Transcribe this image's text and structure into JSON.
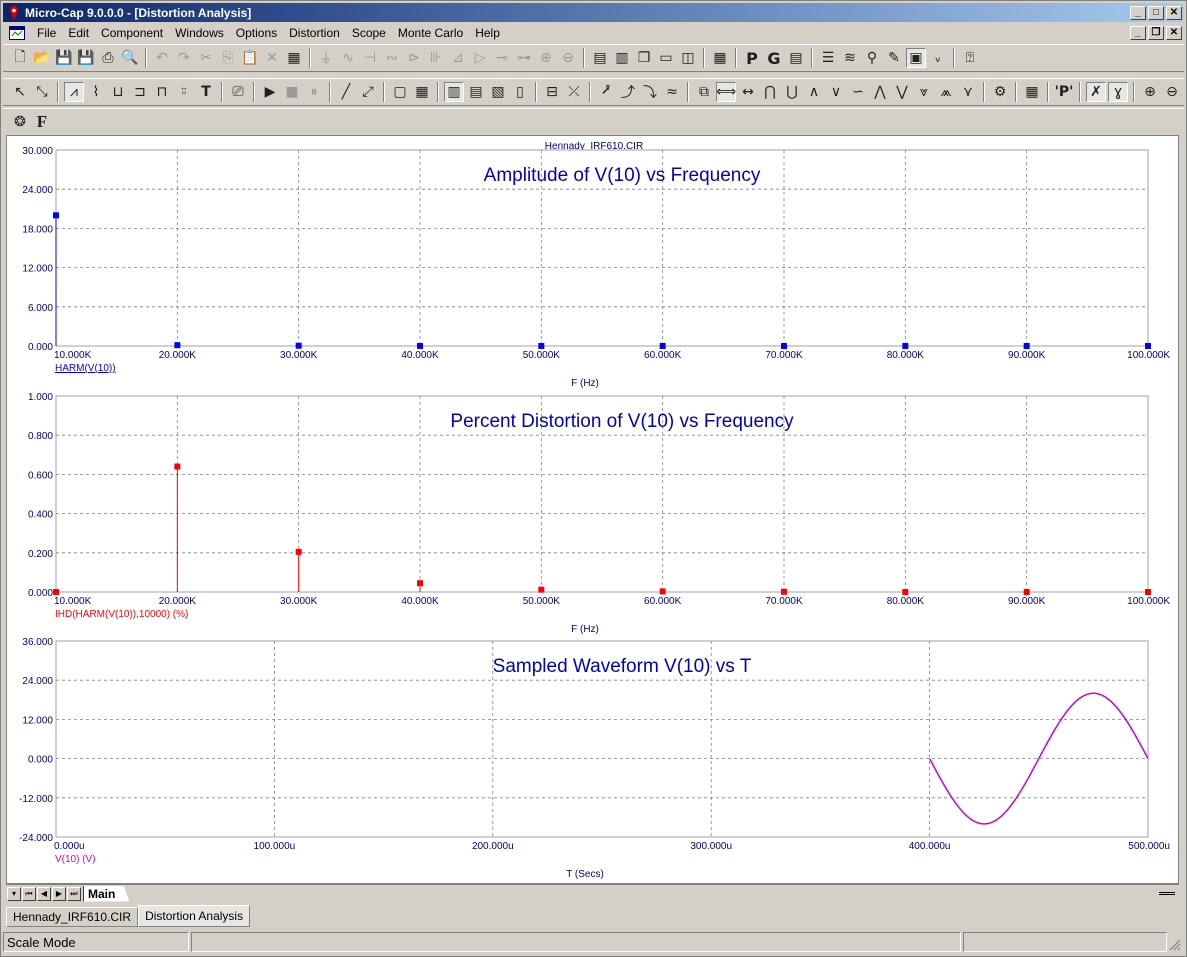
{
  "window": {
    "title": "Micro-Cap 9.0.0.0 - [Distortion Analysis]",
    "min": "_",
    "max": "□",
    "close": "✕",
    "mdi_min": "_",
    "mdi_restore": "❐",
    "mdi_close": "✕"
  },
  "menu": [
    "File",
    "Edit",
    "Component",
    "Windows",
    "Options",
    "Distortion",
    "Scope",
    "Monte Carlo",
    "Help"
  ],
  "toolbar_extra": {
    "f_label": "F"
  },
  "plot": {
    "filename": "Hennady_IRF610.CIR",
    "colors": {
      "axis_text": "#000080",
      "grid": "#808080",
      "amplitude": "#0000ff",
      "distortion": "#ff0000",
      "waveform": "#cc00cc"
    }
  },
  "sheet_tabs": {
    "nav": [
      "▾",
      "⏮",
      "◀",
      "▶",
      "⏭"
    ],
    "active": "Main"
  },
  "doc_tabs": [
    "Hennady_IRF610.CIR",
    "Distortion Analysis"
  ],
  "status": {
    "mode": "Scale Mode"
  },
  "chart_data": [
    {
      "type": "bar",
      "title": "Amplitude of V(10) vs Frequency",
      "xlabel": "F (Hz)",
      "ylabel": "",
      "trace_label": "HARM(V(10))",
      "xlim": [
        10000,
        100000
      ],
      "ylim": [
        0,
        30
      ],
      "xticks": [
        "10.000K",
        "20.000K",
        "30.000K",
        "40.000K",
        "50.000K",
        "60.000K",
        "70.000K",
        "80.000K",
        "90.000K",
        "100.000K"
      ],
      "yticks": [
        "0.000",
        "6.000",
        "12.000",
        "18.000",
        "24.000",
        "30.000"
      ],
      "x": [
        10000,
        20000,
        30000,
        40000,
        50000,
        60000,
        70000,
        80000,
        90000,
        100000
      ],
      "values": [
        20.0,
        0.13,
        0.04,
        0.01,
        0.003,
        0.001,
        0.0,
        0.0,
        0.0,
        0.0
      ],
      "grid": true
    },
    {
      "type": "bar",
      "title": "Percent Distortion of V(10) vs Frequency",
      "xlabel": "F (Hz)",
      "ylabel": "",
      "trace_label": "IHD(HARM(V(10)),10000) (%)",
      "xlim": [
        10000,
        100000
      ],
      "ylim": [
        0,
        1
      ],
      "xticks": [
        "10.000K",
        "20.000K",
        "30.000K",
        "40.000K",
        "50.000K",
        "60.000K",
        "70.000K",
        "80.000K",
        "90.000K",
        "100.000K"
      ],
      "yticks": [
        "0.000",
        "0.200",
        "0.400",
        "0.600",
        "0.800",
        "1.000"
      ],
      "x": [
        10000,
        20000,
        30000,
        40000,
        50000,
        60000,
        70000,
        80000,
        90000,
        100000
      ],
      "values": [
        0.0,
        0.64,
        0.205,
        0.045,
        0.012,
        0.003,
        0.001,
        0.0,
        0.0,
        0.0
      ],
      "grid": true
    },
    {
      "type": "line",
      "title": "Sampled Waveform  V(10) vs T",
      "xlabel": "T (Secs)",
      "ylabel": "",
      "trace_label": "V(10) (V)",
      "xlim": [
        0,
        500
      ],
      "ylim": [
        -24,
        36
      ],
      "xticks": [
        "0.000u",
        "100.000u",
        "200.000u",
        "300.000u",
        "400.000u",
        "500.000u"
      ],
      "yticks": [
        "-24.000",
        "-12.000",
        "0.000",
        "12.000",
        "24.000",
        "36.000"
      ],
      "waveform": {
        "t_start": 400,
        "t_end": 500,
        "amplitude": 20,
        "period": 100,
        "phase": "inverted-sine"
      },
      "grid": true
    }
  ]
}
